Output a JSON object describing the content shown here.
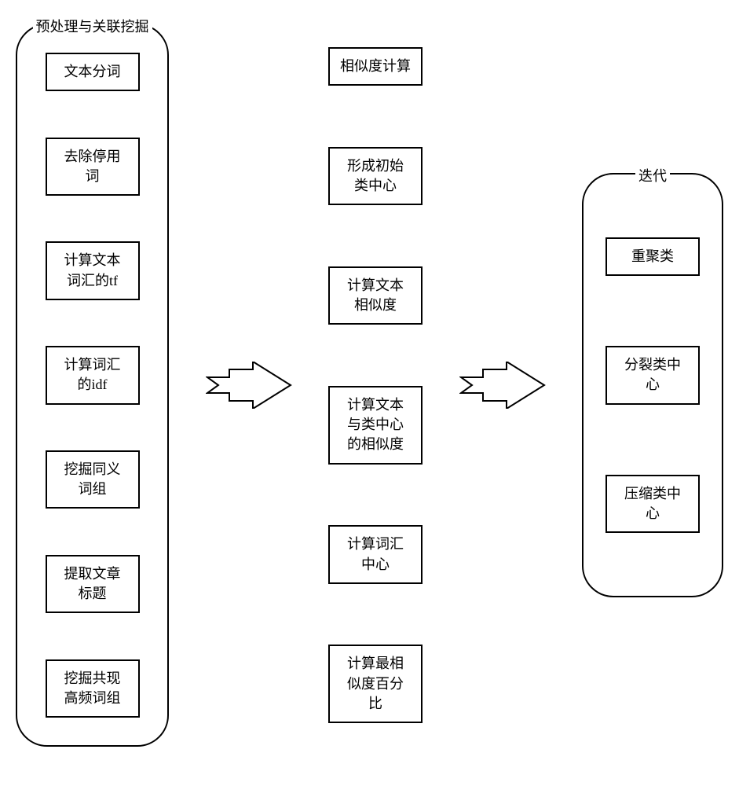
{
  "panels": {
    "left": {
      "title": "预处理与关联挖掘"
    },
    "right": {
      "title": "迭代"
    }
  },
  "left_boxes": {
    "b0": "文本分词",
    "b1": "去除停用\n词",
    "b2": "计算文本\n词汇的tf",
    "b3": "计算词汇\n的idf",
    "b4": "挖掘同义\n词组",
    "b5": "提取文章\n标题",
    "b6": "挖掘共现\n高频词组"
  },
  "middle_boxes": {
    "m0": "相似度计算",
    "m1": "形成初始\n类中心",
    "m2": "计算文本\n相似度",
    "m3": "计算文本\n与类中心\n的相似度",
    "m4": "计算词汇\n中心",
    "m5": "计算最相\n似度百分\n比"
  },
  "right_boxes": {
    "r0": "重聚类",
    "r1": "分裂类中\n心",
    "r2": "压缩类中\n心"
  }
}
